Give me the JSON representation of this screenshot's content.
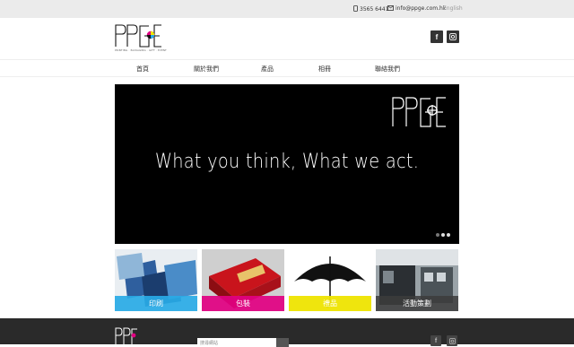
{
  "topbar": {
    "phone": "3565 6441",
    "email": "info@ppge.com.hk",
    "language": "English"
  },
  "header": {
    "logo_alt": "PPGE",
    "logo_tagline": "PRINTING · PACKAGING · GIFT · EVENT",
    "social": [
      "facebook-icon",
      "instagram-icon"
    ]
  },
  "nav": {
    "items": [
      "首頁",
      "關於我們",
      "產品",
      "相冊",
      "聯絡我們"
    ]
  },
  "hero": {
    "slogan": "What you think, What we act.",
    "slides": 3,
    "active_slide": 2
  },
  "categories": [
    {
      "label": "印刷",
      "color": "#28aae6"
    },
    {
      "label": "包裝",
      "color": "#e20082"
    },
    {
      "label": "禮品",
      "color": "#eee400"
    },
    {
      "label": "活動策劃",
      "color": "#3c3c3c"
    }
  ],
  "footer": {
    "search_placeholder": "搜尋網站"
  },
  "colors": {
    "topbar_bg": "#ebebeb",
    "footer_bg": "#2a2a2a",
    "hero_bg": "#000000"
  }
}
